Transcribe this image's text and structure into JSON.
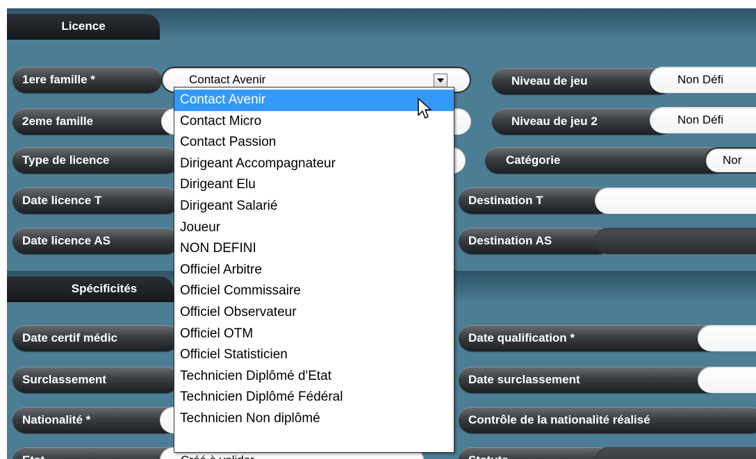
{
  "sections": {
    "licence": "Licence",
    "specificites": "Spécificités"
  },
  "left_fields": [
    {
      "label": "1ere famille *",
      "value": "Contact Avenir"
    },
    {
      "label": "2eme famille",
      "value": ""
    },
    {
      "label": "Type de licence",
      "value": ""
    },
    {
      "label": "Date licence T",
      "value": ""
    },
    {
      "label": "Date licence AS",
      "value": ""
    }
  ],
  "right_fields": [
    {
      "label": "Niveau de jeu",
      "value": "Non Défi"
    },
    {
      "label": "Niveau de jeu 2",
      "value": "Non Défi"
    },
    {
      "label": "Catégorie",
      "value": "Nor"
    },
    {
      "label": "Destination T",
      "value": ""
    },
    {
      "label": "Destination AS",
      "value": ""
    }
  ],
  "spec_left": [
    {
      "label": "Date certif médic",
      "value": ""
    },
    {
      "label": "Surclassement",
      "value": ""
    },
    {
      "label": "Nationalité *",
      "value": ""
    },
    {
      "label": "Etat",
      "value": "Créé à valider"
    }
  ],
  "spec_right": [
    {
      "label": "Date qualification *",
      "value": ""
    },
    {
      "label": "Date surclassement",
      "value": ""
    },
    {
      "label": "Contrôle de la nationalité réalisé",
      "value": ""
    },
    {
      "label": "Statuts",
      "value": ""
    }
  ],
  "dropdown": {
    "selected_index": 0,
    "options": [
      "Contact Avenir",
      "Contact Micro",
      "Contact Passion",
      "Dirigeant Accompagnateur",
      "Dirigeant Elu",
      "Dirigeant Salarié",
      "Joueur",
      "NON DEFINI",
      "Officiel Arbitre",
      "Officiel Commissaire",
      "Officiel Observateur",
      "Officiel OTM",
      "Officiel Statisticien",
      "Technicien Diplômé d'Etat",
      "Technicien Diplômé Fédéral",
      "Technicien Non diplômé"
    ]
  },
  "colors": {
    "panel": "#4b7d94",
    "selection": "#3399ff"
  },
  "icons": {
    "cursor": "mouse-pointer-icon",
    "dropdown": "chevron-down-icon"
  }
}
